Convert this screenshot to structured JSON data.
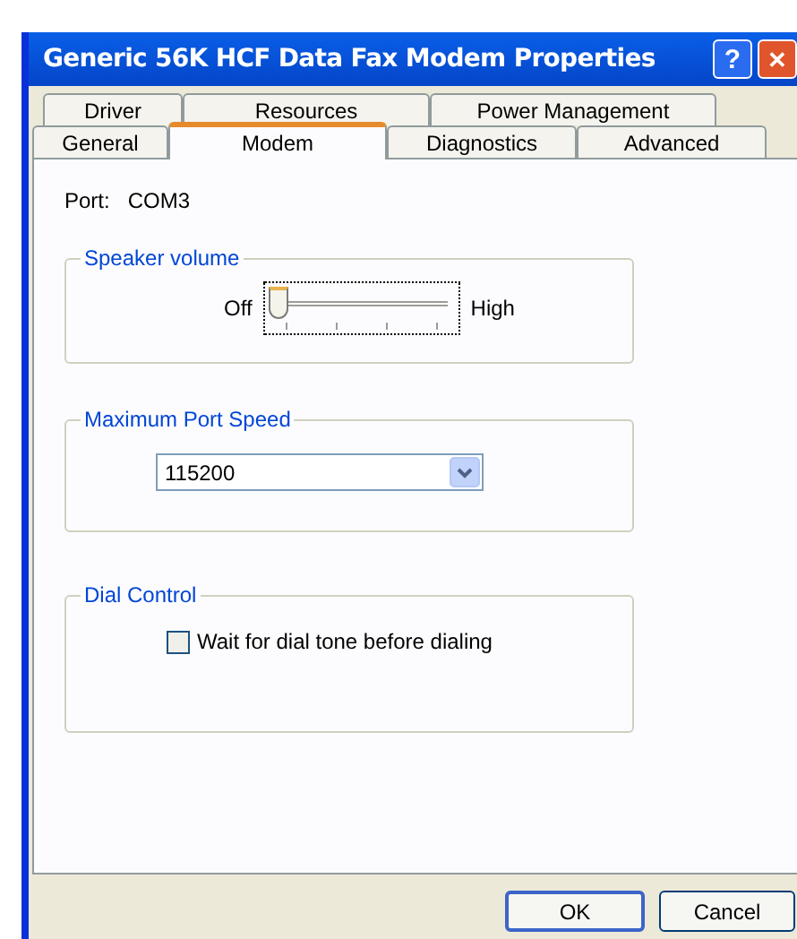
{
  "window": {
    "title": "Generic 56K HCF Data Fax Modem Properties",
    "help": "?",
    "close": "✕"
  },
  "tab_rows": [
    [
      {
        "label": "Driver",
        "selected": false
      },
      {
        "label": "Resources",
        "selected": false
      },
      {
        "label": "Power Management",
        "selected": false
      }
    ],
    [
      {
        "label": "General",
        "selected": false
      },
      {
        "label": "Modem",
        "selected": true
      },
      {
        "label": "Diagnostics",
        "selected": false
      },
      {
        "label": "Advanced",
        "selected": false
      }
    ]
  ],
  "port": {
    "label": "Port:",
    "value": "COM3"
  },
  "speaker_volume": {
    "title": "Speaker volume",
    "min_label": "Off",
    "max_label": "High",
    "level": 0
  },
  "port_speed": {
    "title": "Maximum Port Speed",
    "value": "115200"
  },
  "dial_control": {
    "title": "Dial Control",
    "checkbox": {
      "label": "Wait for dial tone before dialing",
      "checked": false
    }
  },
  "buttons": [
    "OK",
    "Cancel"
  ]
}
